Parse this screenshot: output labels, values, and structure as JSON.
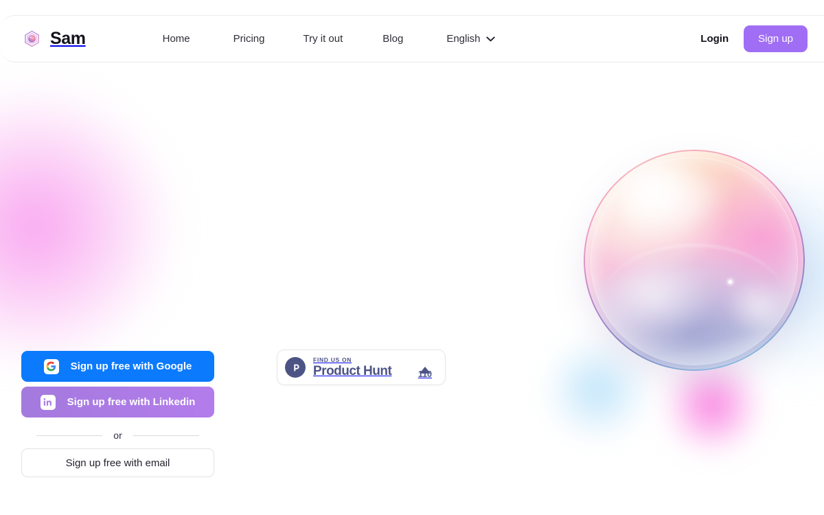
{
  "brand": {
    "name": "Sam",
    "logo_icon": "hexagon-gradient-orb-icon"
  },
  "nav": {
    "items": [
      {
        "label": "Home",
        "name": "nav-home"
      },
      {
        "label": "Pricing",
        "name": "nav-pricing"
      },
      {
        "label": "Try it out",
        "name": "nav-try-it-out"
      },
      {
        "label": "Blog",
        "name": "nav-blog"
      }
    ],
    "language": {
      "label": "English",
      "chevron_icon": "chevron-down-icon"
    }
  },
  "header_actions": {
    "login_label": "Login",
    "signup_label": "Sign up",
    "signup_color": "#a06ef5"
  },
  "auth": {
    "google_label": "Sign up free with Google",
    "google_icon": "google-g-icon",
    "google_color": "#0b7afd",
    "linkedin_label": "Sign up free with Linkedin",
    "linkedin_icon": "linkedin-in-icon",
    "linkedin_color_start": "#a47ade",
    "linkedin_color_end": "#b37ceb",
    "divider_label": "or",
    "email_label": "Sign up free with email"
  },
  "product_hunt": {
    "logo_icon": "product-hunt-p-icon",
    "eyebrow": "FIND US ON",
    "title": "Product Hunt",
    "upvote_icon": "triangle-up-icon",
    "upvote_count": "110",
    "color": "#4d5485"
  },
  "decor": {
    "bubble_icon": "iridescent-bubble-sphere",
    "blob_pink": "#f78ceb",
    "blob_blue": "#96d4f6",
    "blob_magenta": "#f85cd6"
  }
}
